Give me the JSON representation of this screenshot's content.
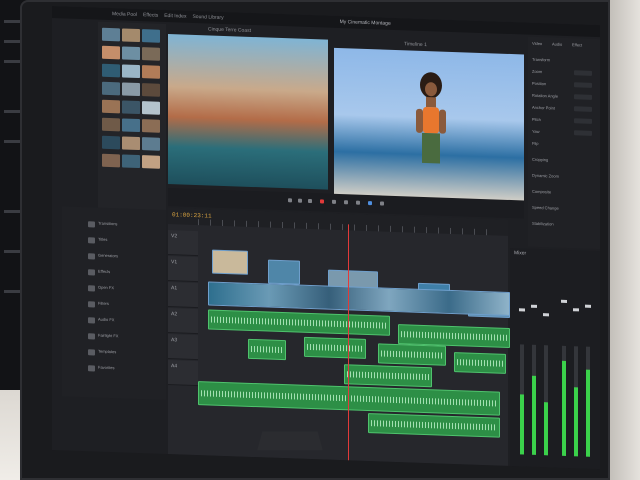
{
  "app": {
    "project_title": "My Cinematic Montage",
    "menu_items": [
      "Media Pool",
      "Effects",
      "Edit Index",
      "Sound Library"
    ],
    "timeline_name": "Timeline 1"
  },
  "timeline": {
    "timecode": "01:00:23:11",
    "tracks": [
      {
        "label": "V2"
      },
      {
        "label": "V1"
      },
      {
        "label": "A1"
      },
      {
        "label": "A2"
      },
      {
        "label": "A3"
      },
      {
        "label": "A4"
      }
    ]
  },
  "viewer": {
    "source_label": "Cinque Terre Coast",
    "record_label": "Timeline 1"
  },
  "inspector": {
    "tabs": [
      "Video",
      "Audio",
      "Effect"
    ],
    "rows": [
      "Transform",
      "Zoom",
      "Position",
      "Rotation Angle",
      "Anchor Point",
      "Pitch",
      "Yaw",
      "Flip",
      "Cropping",
      "Dynamic Zoom",
      "Composite",
      "Speed Change",
      "Stabilization"
    ]
  },
  "effects": {
    "items": [
      "Transitions",
      "Titles",
      "Generators",
      "Effects",
      "Open FX",
      "Filters",
      "Audio FX",
      "Fairlight FX",
      "Templates",
      "Favorites"
    ]
  },
  "mixer": {
    "title": "Mixer",
    "levels": [
      0.55,
      0.72,
      0.48,
      0.86,
      0.63,
      0.79
    ]
  },
  "colors": {
    "accent": "#d9a441",
    "audio_clip": "#2d8f46",
    "meter": "#3bd14b",
    "playhead": "#e23a3a"
  }
}
